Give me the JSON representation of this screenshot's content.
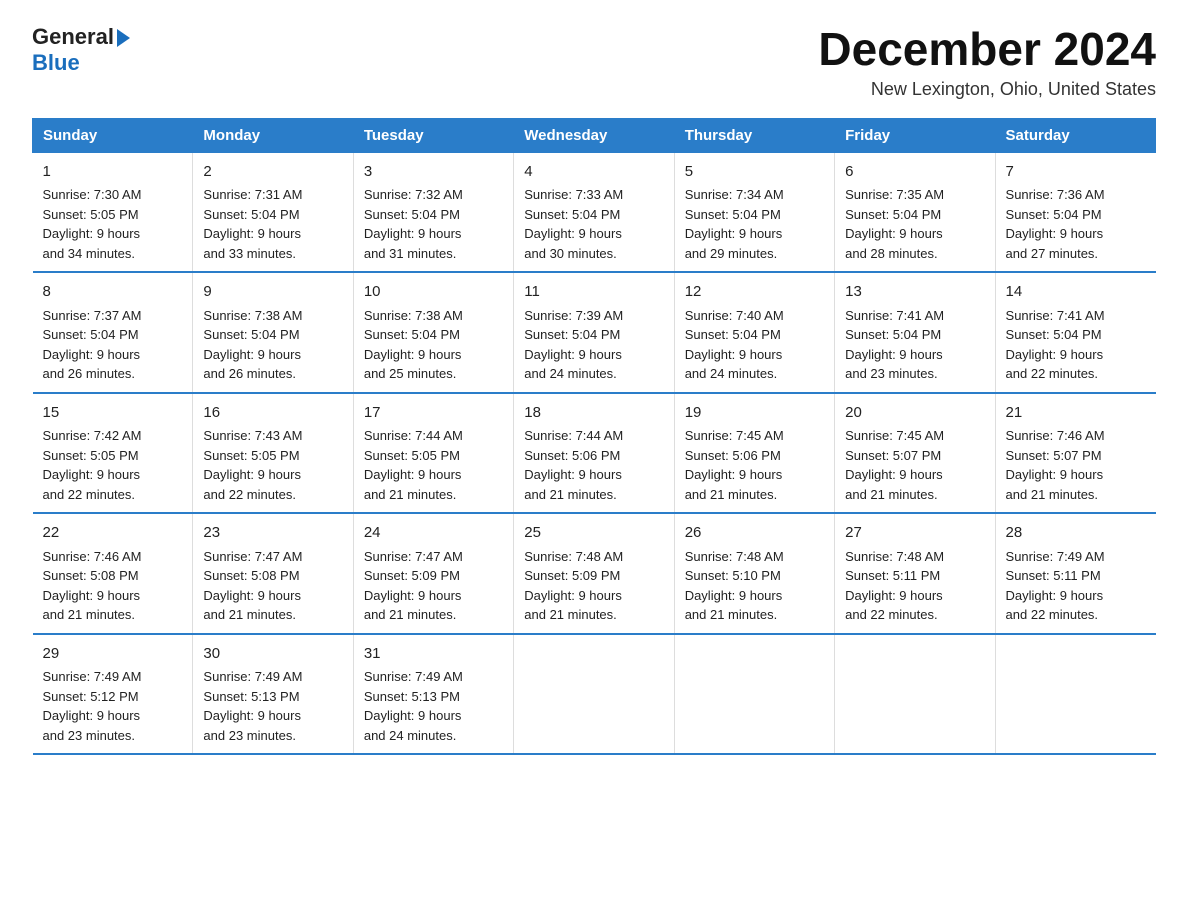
{
  "header": {
    "logo_general": "General",
    "logo_blue": "Blue",
    "month_title": "December 2024",
    "location": "New Lexington, Ohio, United States"
  },
  "days_of_week": [
    "Sunday",
    "Monday",
    "Tuesday",
    "Wednesday",
    "Thursday",
    "Friday",
    "Saturday"
  ],
  "weeks": [
    [
      {
        "day": "1",
        "sunrise": "7:30 AM",
        "sunset": "5:05 PM",
        "daylight": "9 hours and 34 minutes."
      },
      {
        "day": "2",
        "sunrise": "7:31 AM",
        "sunset": "5:04 PM",
        "daylight": "9 hours and 33 minutes."
      },
      {
        "day": "3",
        "sunrise": "7:32 AM",
        "sunset": "5:04 PM",
        "daylight": "9 hours and 31 minutes."
      },
      {
        "day": "4",
        "sunrise": "7:33 AM",
        "sunset": "5:04 PM",
        "daylight": "9 hours and 30 minutes."
      },
      {
        "day": "5",
        "sunrise": "7:34 AM",
        "sunset": "5:04 PM",
        "daylight": "9 hours and 29 minutes."
      },
      {
        "day": "6",
        "sunrise": "7:35 AM",
        "sunset": "5:04 PM",
        "daylight": "9 hours and 28 minutes."
      },
      {
        "day": "7",
        "sunrise": "7:36 AM",
        "sunset": "5:04 PM",
        "daylight": "9 hours and 27 minutes."
      }
    ],
    [
      {
        "day": "8",
        "sunrise": "7:37 AM",
        "sunset": "5:04 PM",
        "daylight": "9 hours and 26 minutes."
      },
      {
        "day": "9",
        "sunrise": "7:38 AM",
        "sunset": "5:04 PM",
        "daylight": "9 hours and 26 minutes."
      },
      {
        "day": "10",
        "sunrise": "7:38 AM",
        "sunset": "5:04 PM",
        "daylight": "9 hours and 25 minutes."
      },
      {
        "day": "11",
        "sunrise": "7:39 AM",
        "sunset": "5:04 PM",
        "daylight": "9 hours and 24 minutes."
      },
      {
        "day": "12",
        "sunrise": "7:40 AM",
        "sunset": "5:04 PM",
        "daylight": "9 hours and 24 minutes."
      },
      {
        "day": "13",
        "sunrise": "7:41 AM",
        "sunset": "5:04 PM",
        "daylight": "9 hours and 23 minutes."
      },
      {
        "day": "14",
        "sunrise": "7:41 AM",
        "sunset": "5:04 PM",
        "daylight": "9 hours and 22 minutes."
      }
    ],
    [
      {
        "day": "15",
        "sunrise": "7:42 AM",
        "sunset": "5:05 PM",
        "daylight": "9 hours and 22 minutes."
      },
      {
        "day": "16",
        "sunrise": "7:43 AM",
        "sunset": "5:05 PM",
        "daylight": "9 hours and 22 minutes."
      },
      {
        "day": "17",
        "sunrise": "7:44 AM",
        "sunset": "5:05 PM",
        "daylight": "9 hours and 21 minutes."
      },
      {
        "day": "18",
        "sunrise": "7:44 AM",
        "sunset": "5:06 PM",
        "daylight": "9 hours and 21 minutes."
      },
      {
        "day": "19",
        "sunrise": "7:45 AM",
        "sunset": "5:06 PM",
        "daylight": "9 hours and 21 minutes."
      },
      {
        "day": "20",
        "sunrise": "7:45 AM",
        "sunset": "5:07 PM",
        "daylight": "9 hours and 21 minutes."
      },
      {
        "day": "21",
        "sunrise": "7:46 AM",
        "sunset": "5:07 PM",
        "daylight": "9 hours and 21 minutes."
      }
    ],
    [
      {
        "day": "22",
        "sunrise": "7:46 AM",
        "sunset": "5:08 PM",
        "daylight": "9 hours and 21 minutes."
      },
      {
        "day": "23",
        "sunrise": "7:47 AM",
        "sunset": "5:08 PM",
        "daylight": "9 hours and 21 minutes."
      },
      {
        "day": "24",
        "sunrise": "7:47 AM",
        "sunset": "5:09 PM",
        "daylight": "9 hours and 21 minutes."
      },
      {
        "day": "25",
        "sunrise": "7:48 AM",
        "sunset": "5:09 PM",
        "daylight": "9 hours and 21 minutes."
      },
      {
        "day": "26",
        "sunrise": "7:48 AM",
        "sunset": "5:10 PM",
        "daylight": "9 hours and 21 minutes."
      },
      {
        "day": "27",
        "sunrise": "7:48 AM",
        "sunset": "5:11 PM",
        "daylight": "9 hours and 22 minutes."
      },
      {
        "day": "28",
        "sunrise": "7:49 AM",
        "sunset": "5:11 PM",
        "daylight": "9 hours and 22 minutes."
      }
    ],
    [
      {
        "day": "29",
        "sunrise": "7:49 AM",
        "sunset": "5:12 PM",
        "daylight": "9 hours and 23 minutes."
      },
      {
        "day": "30",
        "sunrise": "7:49 AM",
        "sunset": "5:13 PM",
        "daylight": "9 hours and 23 minutes."
      },
      {
        "day": "31",
        "sunrise": "7:49 AM",
        "sunset": "5:13 PM",
        "daylight": "9 hours and 24 minutes."
      },
      null,
      null,
      null,
      null
    ]
  ],
  "labels": {
    "sunrise": "Sunrise:",
    "sunset": "Sunset:",
    "daylight": "Daylight:"
  },
  "accent_color": "#2a7dc9"
}
